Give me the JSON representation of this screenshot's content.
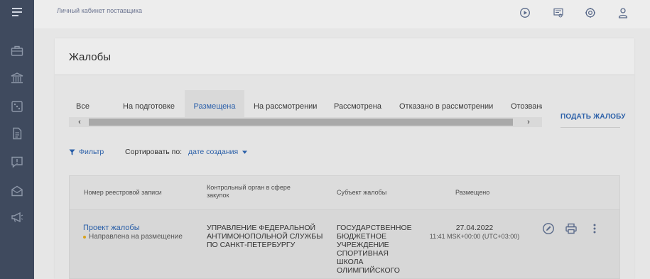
{
  "topbar": {
    "title": "Личный кабинет поставщика",
    "icons": [
      "play-circle-icon",
      "certificate-icon",
      "settings-gear-icon",
      "user-icon"
    ]
  },
  "sidebar": {
    "items": [
      "menu-icon",
      "briefcase-icon",
      "bank-icon",
      "dice-icon",
      "document-icon",
      "alert-icon",
      "mail-icon",
      "megaphone-icon"
    ]
  },
  "page": {
    "title": "Жалобы"
  },
  "tabs": [
    {
      "label": "Все",
      "active": false
    },
    {
      "label": "На подготовке",
      "active": false
    },
    {
      "label": "Размещена",
      "active": true
    },
    {
      "label": "На рассмотрении",
      "active": false
    },
    {
      "label": "Рассмотрена",
      "active": false
    },
    {
      "label": "Отказано в рассмотрении",
      "active": false
    },
    {
      "label": "Отозвана",
      "active": false
    }
  ],
  "actions": {
    "submit_complaint": "ПОДАТЬ ЖАЛОБУ"
  },
  "filters": {
    "filter_label": "Фильтр",
    "sort_label": "Сортировать по:",
    "sort_value": "дате создания"
  },
  "table": {
    "headers": {
      "registry_number": "Номер реестровой записи",
      "control_body": "Контрольный орган в сфере закупок",
      "subject": "Субъект жалобы",
      "posted": "Размещено"
    },
    "rows": [
      {
        "title": "Проект жалобы",
        "status": "Направлена на размещение",
        "control_body": "УПРАВЛЕНИЕ ФЕДЕРАЛЬНОЙ АНТИМОНОПОЛЬНОЙ СЛУЖБЫ ПО САНКТ-ПЕТЕРБУРГУ",
        "subject": "ГОСУДАРСТВЕННОЕ БЮДЖЕТНОЕ УЧРЕЖДЕНИЕ СПОРТИВНАЯ ШКОЛА ОЛИМПИЙСКОГО",
        "date": "27.04.2022",
        "time": "11:41 MSK+00:00 (UTC+03:00)"
      }
    ]
  },
  "colors": {
    "sidebar": "#3f4a5e",
    "accent": "#2a5fa8",
    "status_dot": "#d9a21b"
  }
}
